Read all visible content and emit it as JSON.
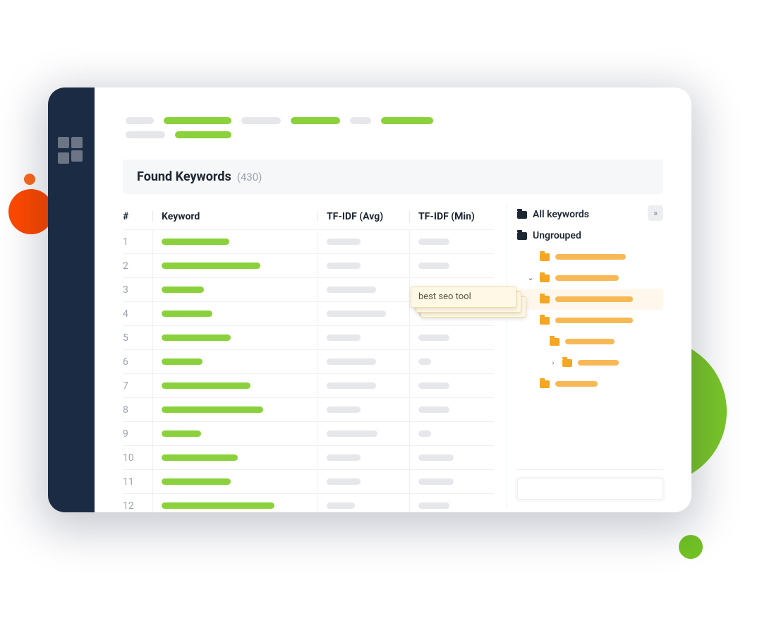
{
  "header": {
    "title": "Found Keywords",
    "count_label": "(430)"
  },
  "columns": {
    "num": "#",
    "keyword": "Keyword",
    "avg": "TF-IDF (Avg)",
    "min": "TF-IDF (Min)"
  },
  "breadcrumb_widths": {
    "row1": [
      {
        "w": 40,
        "c": "grey"
      },
      {
        "w": 96,
        "c": "green"
      },
      {
        "w": 56,
        "c": "grey"
      },
      {
        "w": 70,
        "c": "green"
      },
      {
        "w": 30,
        "c": "grey"
      },
      {
        "w": 74,
        "c": "green"
      }
    ],
    "row2": [
      {
        "w": 56,
        "c": "grey"
      },
      {
        "w": 80,
        "c": "green"
      }
    ]
  },
  "rows": [
    {
      "n": "1",
      "kw": 96,
      "avg": 48,
      "min": 44
    },
    {
      "n": "2",
      "kw": 140,
      "avg": 48,
      "min": 44
    },
    {
      "n": "3",
      "kw": 60,
      "avg": 70,
      "min": 18
    },
    {
      "n": "4",
      "kw": 72,
      "avg": 84,
      "min": 44
    },
    {
      "n": "5",
      "kw": 98,
      "avg": 48,
      "min": 44
    },
    {
      "n": "6",
      "kw": 58,
      "avg": 70,
      "min": 18
    },
    {
      "n": "7",
      "kw": 126,
      "avg": 70,
      "min": 44
    },
    {
      "n": "8",
      "kw": 144,
      "avg": 48,
      "min": 44
    },
    {
      "n": "9",
      "kw": 56,
      "avg": 72,
      "min": 18
    },
    {
      "n": "10",
      "kw": 108,
      "avg": 48,
      "min": 50
    },
    {
      "n": "11",
      "kw": 98,
      "avg": 48,
      "min": 50
    },
    {
      "n": "12",
      "kw": 160,
      "avg": 40,
      "min": 44
    }
  ],
  "side": {
    "all": "All keywords",
    "ungrouped": "Ungrouped",
    "groups": [
      {
        "indent": 1,
        "chev": "",
        "highlight": false,
        "w": 100
      },
      {
        "indent": 1,
        "chev": "⌄",
        "highlight": false,
        "w": 90
      },
      {
        "indent": 2,
        "chev": "",
        "highlight": true,
        "w": 110
      },
      {
        "indent": 2,
        "chev": "",
        "highlight": false,
        "w": 110
      },
      {
        "indent": 3,
        "chev": "",
        "highlight": false,
        "w": 70
      },
      {
        "indent": 3,
        "chev": "›",
        "highlight": false,
        "w": 58
      },
      {
        "indent": 2,
        "chev": "",
        "highlight": false,
        "w": 60
      }
    ]
  },
  "tooltip": {
    "text": "best seo tool"
  }
}
